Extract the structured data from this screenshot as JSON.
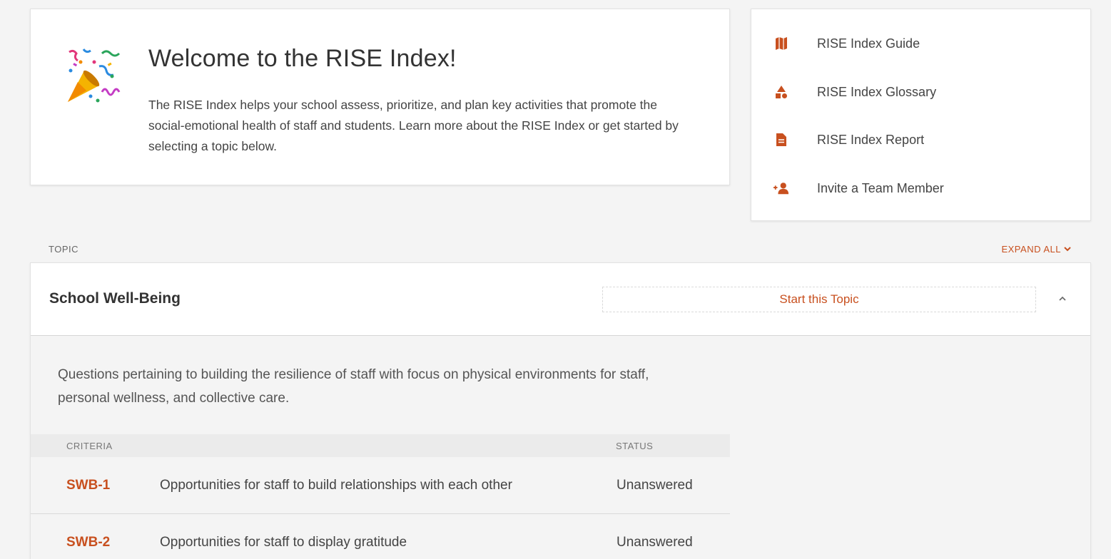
{
  "welcome": {
    "title": "Welcome to the RISE Index!",
    "description": "The RISE Index helps your school assess, prioritize, and plan key activities that promote the social-emotional health of staff and students. Learn more about the RISE Index or get started by selecting a topic below.",
    "icon": "party-popper-icon"
  },
  "links": [
    {
      "label": "RISE Index Guide",
      "icon": "map-icon"
    },
    {
      "label": "RISE Index Glossary",
      "icon": "shapes-icon"
    },
    {
      "label": "RISE Index Report",
      "icon": "document-icon"
    },
    {
      "label": "Invite a Team Member",
      "icon": "user-plus-icon"
    }
  ],
  "topics_header": {
    "label": "TOPIC",
    "expand_all": "EXPAND ALL"
  },
  "topic": {
    "title": "School Well-Being",
    "start_label": "Start this Topic",
    "description": "Questions pertaining to building the resilience of staff with focus on physical environments for staff, personal wellness, and collective care.",
    "columns": {
      "criteria": "CRITERIA",
      "status": "STATUS"
    },
    "criteria": [
      {
        "code": "SWB-1",
        "text": "Opportunities for staff to build relationships with each other",
        "status": "Unanswered"
      },
      {
        "code": "SWB-2",
        "text": "Opportunities for staff to display gratitude",
        "status": "Unanswered"
      }
    ]
  },
  "colors": {
    "accent": "#c8501f",
    "background": "#f4f4f4"
  }
}
